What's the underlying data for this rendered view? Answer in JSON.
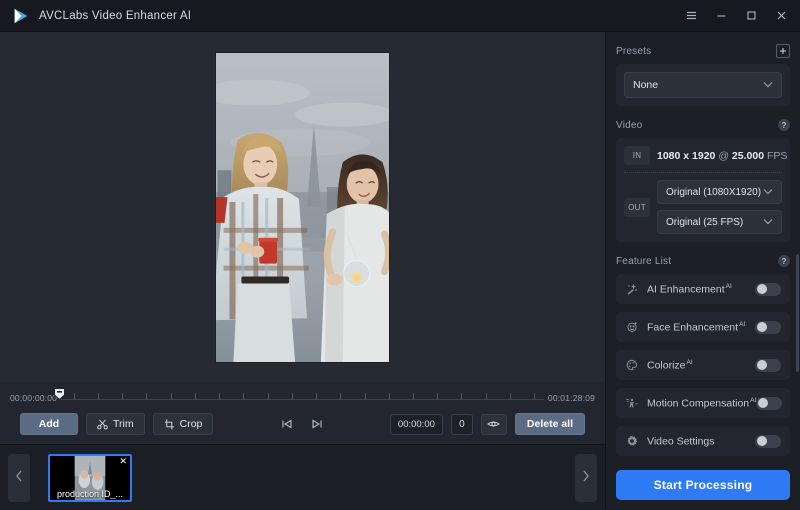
{
  "titlebar": {
    "app_title": "AVCLabs Video Enhancer AI",
    "logo_icon": "play-triangle-logo",
    "menu_icon": "hamburger-menu-icon",
    "minimize_icon": "minimize-icon",
    "maximize_icon": "maximize-icon",
    "close_icon": "close-icon"
  },
  "preview": {
    "media_description": "Two women on a rooftop at dusk holding red cups with a city skyline behind them"
  },
  "timeline": {
    "start_time": "00:00:00:00",
    "end_time": "00:01:28:09",
    "playhead_icon": "playhead-marker"
  },
  "toolbar": {
    "add_label": "Add",
    "trim_label": "Trim",
    "crop_label": "Crop",
    "trim_icon": "scissors-icon",
    "crop_icon": "crop-icon",
    "prev_frame_icon": "skip-previous-icon",
    "next_frame_icon": "skip-next-icon",
    "current_time": "00:00:00",
    "frame_number": "0",
    "preview_icon": "eye-icon",
    "delete_all_label": "Delete all"
  },
  "strip": {
    "prev_icon": "chevron-left-icon",
    "next_icon": "chevron-right-icon",
    "items": [
      {
        "label": "production ID_...",
        "remove_icon": "close-icon",
        "selected": true
      }
    ]
  },
  "panel": {
    "presets": {
      "title": "Presets",
      "add_icon": "plus-icon",
      "selected": "None",
      "caret_icon": "chevron-down-icon"
    },
    "video": {
      "title": "Video",
      "help_icon": "help-circle-icon",
      "in_label": "IN",
      "in_resolution": "1080 x 1920",
      "in_sep_x": "x",
      "in_at": "@",
      "in_fps_value": "25.000",
      "in_fps_unit": "FPS",
      "in_value": "1080 x 1920 @ 25.000 FPS",
      "out_label": "OUT",
      "out_resolution": "Original (1080X1920)",
      "out_framerate": "Original (25 FPS)",
      "caret_icon": "chevron-down-icon"
    },
    "feature_list": {
      "title": "Feature List",
      "help_icon": "help-circle-icon",
      "items": [
        {
          "label": "AI Enhancement",
          "sup": "AI",
          "icon": "sparkle-wand-icon",
          "enabled": false
        },
        {
          "label": "Face Enhancement",
          "sup": "AI",
          "icon": "face-icon",
          "enabled": false
        },
        {
          "label": "Colorize",
          "sup": "AI",
          "icon": "palette-icon",
          "enabled": false
        },
        {
          "label": "Motion Compensation",
          "sup": "AI",
          "icon": "motion-icon",
          "enabled": false
        },
        {
          "label": "Video Settings",
          "sup": "",
          "icon": "gear-icon",
          "enabled": false
        }
      ]
    },
    "start_button": "Start Processing"
  },
  "colors": {
    "accent": "#2f7bf6",
    "panel_bg": "#1c1f26",
    "canvas_bg": "#262a33",
    "card_bg": "#23262e",
    "titlebar_bg": "#17191e",
    "button_blue_gray": "#5a6b84"
  }
}
